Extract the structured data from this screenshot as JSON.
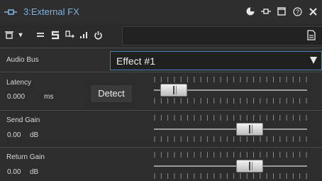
{
  "window": {
    "title": "3:External FX"
  },
  "audio_bus": {
    "label": "Audio Bus",
    "selected": "Effect #1"
  },
  "latency": {
    "label": "Latency",
    "value": "0.000",
    "unit": "ms",
    "detect_label": "Detect",
    "level": 0.05
  },
  "send_gain": {
    "label": "Send Gain",
    "value": "0.00",
    "unit": "dB",
    "level": 0.65
  },
  "return_gain": {
    "label": "Return Gain",
    "value": "0.00",
    "unit": "dB",
    "level": 0.65
  }
}
